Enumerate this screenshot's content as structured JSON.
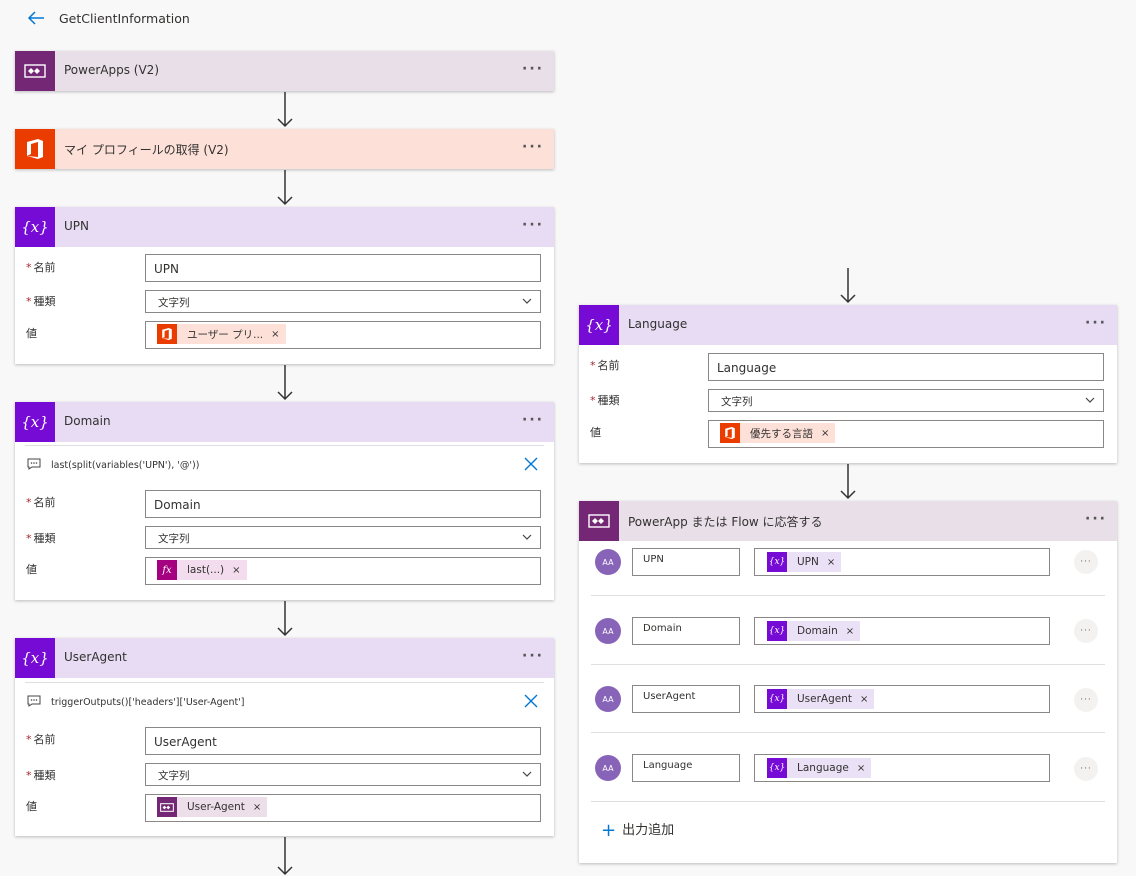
{
  "header": {
    "title": "GetClientInformation"
  },
  "trigger": {
    "title": "PowerApps (V2)"
  },
  "profile": {
    "title": "マイ プロフィールの取得 (V2)"
  },
  "labels": {
    "name": "名前",
    "type": "種類",
    "value": "値",
    "required": "*"
  },
  "upn": {
    "title": "UPN",
    "name_value": "UPN",
    "type_value": "文字列",
    "token_label": "ユーザー プリ...",
    "remove": "×"
  },
  "domain": {
    "title": "Domain",
    "comment": "last(split(variables('UPN'), '@'))",
    "name_value": "Domain",
    "type_value": "文字列",
    "token_icon": "fx",
    "token_label": "last(...)",
    "remove": "×"
  },
  "useragent": {
    "title": "UserAgent",
    "comment": "triggerOutputs()['headers']['User-Agent']",
    "name_value": "UserAgent",
    "type_value": "文字列",
    "token_label": "User-Agent",
    "remove": "×"
  },
  "language": {
    "title": "Language",
    "name_value": "Language",
    "type_value": "文字列",
    "token_label": "優先する言語",
    "remove": "×"
  },
  "response": {
    "title": "PowerApp または Flow に応答する",
    "avatar_text": "AA",
    "token_icon": "{x}",
    "rows": [
      {
        "key": "UPN",
        "token": "UPN",
        "remove": "×"
      },
      {
        "key": "Domain",
        "token": "Domain",
        "remove": "×"
      },
      {
        "key": "UserAgent",
        "token": "UserAgent",
        "remove": "×"
      },
      {
        "key": "Language",
        "token": "Language",
        "remove": "×"
      }
    ],
    "more": "···",
    "add_label": "出力追加",
    "add_icon": "+"
  },
  "menu_dots": "···",
  "var_icon": "{x}",
  "colors": {
    "accent": "#0078d4",
    "powerapps": "#742774",
    "office": "#eb3c00",
    "variable": "#770bd6",
    "expression": "#a4007f"
  }
}
